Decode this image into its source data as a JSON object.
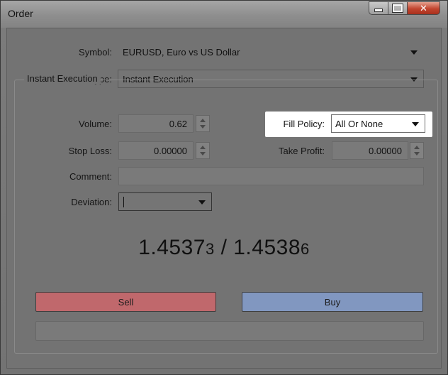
{
  "window": {
    "title": "Order"
  },
  "form": {
    "symbol_label": "Symbol:",
    "symbol_value": "EURUSD, Euro vs US Dollar",
    "type_label": "Type:",
    "type_value": "Instant Execution",
    "group_title": "Instant Execution",
    "volume_label": "Volume:",
    "volume_value": "0.62",
    "fill_policy_label": "Fill Policy:",
    "fill_policy_value": "All Or None",
    "stop_loss_label": "Stop Loss:",
    "stop_loss_value": "0.00000",
    "take_profit_label": "Take Profit:",
    "take_profit_value": "0.00000",
    "comment_label": "Comment:",
    "comment_value": "",
    "deviation_label": "Deviation:",
    "deviation_value": ""
  },
  "quote": {
    "bid_main": "1.4537",
    "bid_small": "3",
    "separator": " / ",
    "ask_main": "1.4538",
    "ask_small": "6"
  },
  "actions": {
    "sell_label": "Sell",
    "buy_label": "Buy"
  },
  "colors": {
    "sell": "#c0686c",
    "buy": "#8197c0"
  }
}
